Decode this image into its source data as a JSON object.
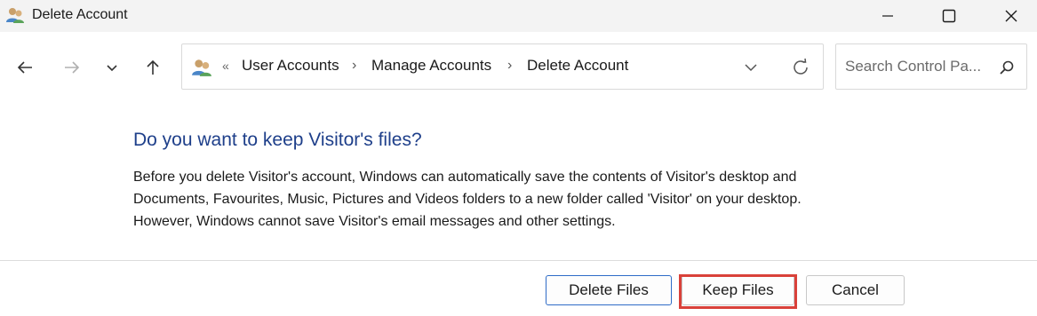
{
  "window": {
    "title": "Delete Account",
    "minimize_label": "",
    "maximize_label": "",
    "close_label": ""
  },
  "address": {
    "overflow_chevron": "«",
    "crumbs": [
      "User Accounts",
      "Manage Accounts",
      "Delete Account"
    ],
    "separator": "›"
  },
  "search": {
    "placeholder": "Search Control Pa..."
  },
  "content": {
    "heading": "Do you want to keep Visitor's files?",
    "lines": [
      "Before you delete Visitor's account, Windows can automatically save the contents of Visitor's desktop and",
      "Documents, Favourites, Music, Pictures and Videos folders to a new folder called 'Visitor' on your desktop.",
      "However, Windows cannot save Visitor's email messages and other settings."
    ]
  },
  "buttons": {
    "delete": "Delete Files",
    "keep": "Keep Files",
    "cancel": "Cancel"
  },
  "colors": {
    "heading": "#1e3f8a",
    "highlight": "#d9413a",
    "focus_border": "#2f6cc7"
  },
  "icons": {
    "app": "users-icon",
    "back": "arrow-left-icon",
    "forward": "arrow-right-icon",
    "recent": "chevron-down-icon",
    "up": "arrow-up-icon",
    "dropdown": "chevron-down-icon",
    "refresh": "refresh-icon",
    "search": "search-icon"
  }
}
